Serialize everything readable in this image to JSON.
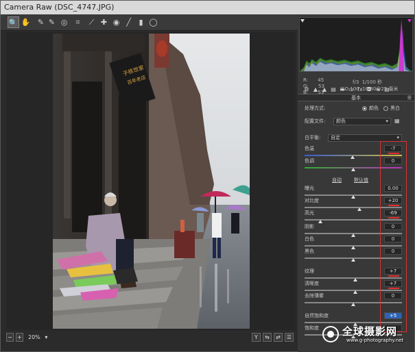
{
  "window": {
    "title": "Camera Raw (DSC_4747.JPG)"
  },
  "toolbar": {
    "tools": [
      {
        "name": "zoom-tool",
        "glyph": "🔍"
      },
      {
        "name": "hand-tool",
        "glyph": "✋"
      },
      {
        "name": "white-balance-tool",
        "glyph": "✎"
      },
      {
        "name": "color-sampler-tool",
        "glyph": "✎"
      },
      {
        "name": "targeted-adjustment-tool",
        "glyph": "◎"
      },
      {
        "name": "crop-tool",
        "glyph": "⌗"
      },
      {
        "name": "straighten-tool",
        "glyph": "⟋"
      },
      {
        "name": "spot-removal-tool",
        "glyph": "✚"
      },
      {
        "name": "red-eye-tool",
        "glyph": "◉"
      },
      {
        "name": "adjustment-brush-tool",
        "glyph": "╱"
      },
      {
        "name": "graduated-filter-tool",
        "glyph": "▮"
      },
      {
        "name": "radial-filter-tool",
        "glyph": "◯"
      }
    ],
    "open_prefs_glyph": "⇱"
  },
  "histogram": {
    "colors": {
      "red": "#d03030",
      "green": "#30c030",
      "blue": "#3050e0",
      "magenta": "#d030d0",
      "white": "#e8e8e8"
    }
  },
  "rgb_readout": {
    "r_label": "R:",
    "r_value": "45",
    "g_label": "G:",
    "g_value": "53",
    "b_label": "B:",
    "b_value": "53"
  },
  "camera_info": {
    "aperture": "f/3",
    "shutter": "1/100 秒",
    "iso": "ISO 100",
    "lens": "16-80@25 毫米"
  },
  "panel": {
    "section_title": "基本",
    "treatment_label": "处理方式:",
    "treatment_color": "颜色",
    "treatment_bw": "黑白",
    "profile_label": "配置文件:",
    "profile_value": "颜色",
    "wb_label": "白平衡:",
    "wb_value": "自定",
    "auto_link": "自动",
    "default_link": "默认值"
  },
  "sliders": [
    {
      "id": "temperature",
      "label": "色温",
      "value": "-7",
      "pos": 0.49,
      "gradient": "temp"
    },
    {
      "id": "tint",
      "label": "色调",
      "value": "0",
      "pos": 0.5,
      "gradient": "tint"
    },
    {
      "id": "exposure",
      "label": "曝光",
      "value": "0.00",
      "pos": 0.5
    },
    {
      "id": "contrast",
      "label": "对比度",
      "value": "+20",
      "pos": 0.56,
      "marked": true
    },
    {
      "id": "highlights",
      "label": "高光",
      "value": "-69",
      "pos": 0.16,
      "marked": true
    },
    {
      "id": "shadows",
      "label": "阴影",
      "value": "0",
      "pos": 0.5
    },
    {
      "id": "whites",
      "label": "白色",
      "value": "0",
      "pos": 0.5
    },
    {
      "id": "blacks",
      "label": "黑色",
      "value": "0",
      "pos": 0.5
    },
    {
      "id": "texture",
      "label": "纹理",
      "value": "+7",
      "pos": 0.52,
      "marked": true
    },
    {
      "id": "clarity",
      "label": "清晰度",
      "value": "+7",
      "pos": 0.52,
      "marked": true
    },
    {
      "id": "dehaze",
      "label": "去除薄雾",
      "value": "0",
      "pos": 0.5
    },
    {
      "id": "vibrance",
      "label": "自然饱和度",
      "value": "+5",
      "pos": 0.52,
      "highlight": true
    },
    {
      "id": "saturation",
      "label": "饱和度",
      "value": "",
      "pos": 0.5
    }
  ],
  "bottom": {
    "zoom_value": "20%",
    "btn_y": "Y",
    "btn_compare": "⇆",
    "btn_swap": "⇄",
    "btn_prefs": "☰",
    "btn_minus": "−",
    "btn_plus": "+"
  },
  "photo": {
    "sign_text": "子栋世家",
    "sign_text2": "百年老店"
  },
  "watermark": {
    "title": "全球摄影网",
    "url": "www.g-photography.net"
  }
}
